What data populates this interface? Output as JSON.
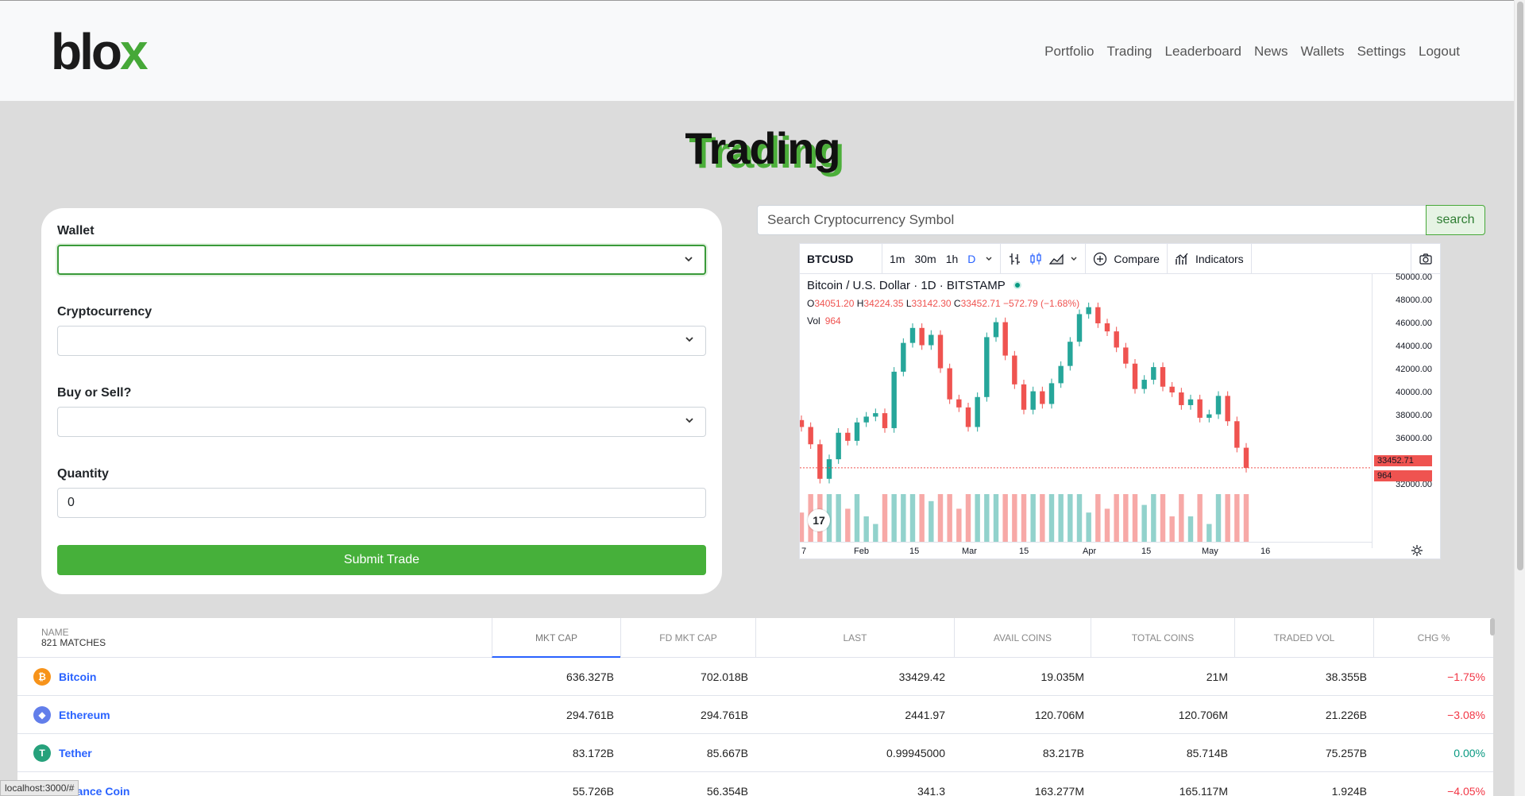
{
  "navbar": {
    "logo_main": "blo",
    "logo_accent": "x",
    "links": [
      "Portfolio",
      "Trading",
      "Leaderboard",
      "News",
      "Wallets",
      "Settings",
      "Logout"
    ]
  },
  "page": {
    "title": "Trading"
  },
  "form": {
    "wallet_label": "Wallet",
    "crypto_label": "Cryptocurrency",
    "side_label": "Buy or Sell?",
    "quantity_label": "Quantity",
    "quantity_value": "0",
    "submit_label": "Submit Trade"
  },
  "search": {
    "placeholder": "Search Cryptocurrency Symbol",
    "button_label": "search"
  },
  "chart_widget": {
    "symbol": "BTCUSD",
    "intervals": [
      "1m",
      "30m",
      "1h",
      "D"
    ],
    "active_interval": "D",
    "compare_label": "Compare",
    "indicators_label": "Indicators",
    "legend": "Bitcoin / U.S. Dollar · 1D · BITSTAMP",
    "ohlc": {
      "o": "34051.20",
      "h": "34224.35",
      "l": "33142.30",
      "c": "33452.71",
      "chg": "−572.79 (−1.68%)"
    },
    "vol_label": "Vol",
    "vol_value": "964",
    "last_price_tag": "33452.71",
    "vol_tag": "964",
    "logo": "17"
  },
  "chart_data": {
    "type": "candlestick",
    "x_labels": [
      "7",
      "Feb",
      "15",
      "Mar",
      "15",
      "Apr",
      "15",
      "May",
      "16"
    ],
    "y_ticks": [
      "50000.00",
      "48000.00",
      "46000.00",
      "44000.00",
      "42000.00",
      "40000.00",
      "38000.00",
      "36000.00",
      "34000.00",
      "32000.00"
    ],
    "ylim": [
      32000,
      50000
    ],
    "close_series": [
      37000,
      35500,
      32500,
      34200,
      36500,
      35800,
      37400,
      37900,
      38200,
      36900,
      41800,
      44300,
      45600,
      44100,
      45000,
      42100,
      39400,
      38700,
      37000,
      39600,
      44800,
      46100,
      43200,
      40700,
      38500,
      40100,
      39000,
      40800,
      42300,
      44400,
      46800,
      47400,
      46000,
      45300,
      43900,
      42500,
      40300,
      41100,
      42200,
      40500,
      40000,
      38900,
      39400,
      37800,
      38100,
      39700,
      37500,
      35200,
      33452.71
    ]
  },
  "table": {
    "name_header": "NAME",
    "matches": "821 MATCHES",
    "headers": [
      "MKT CAP",
      "FD MKT CAP",
      "LAST",
      "AVAIL COINS",
      "TOTAL COINS",
      "TRADED VOL",
      "CHG %"
    ],
    "rows": [
      {
        "icon": "₿",
        "color": "#f7931a",
        "name": "Bitcoin",
        "values": [
          "636.327B",
          "702.018B",
          "33429.42",
          "19.035M",
          "21M",
          "38.355B",
          "−1.75%"
        ],
        "dir": "neg"
      },
      {
        "icon": "◆",
        "color": "#627eea",
        "name": "Ethereum",
        "values": [
          "294.761B",
          "294.761B",
          "2441.97",
          "120.706M",
          "120.706M",
          "21.226B",
          "−3.08%"
        ],
        "dir": "neg"
      },
      {
        "icon": "T",
        "color": "#26a17b",
        "name": "Tether",
        "values": [
          "83.172B",
          "85.667B",
          "0.99945000",
          "83.217B",
          "85.714B",
          "75.257B",
          "0.00%"
        ],
        "dir": "pos"
      },
      {
        "icon": "B",
        "color": "#f3ba2f",
        "name": "Binance Coin",
        "values": [
          "55.726B",
          "56.354B",
          "341.3",
          "163.277M",
          "165.117M",
          "1.924B",
          "−4.05%"
        ],
        "dir": "neg"
      }
    ]
  },
  "status_bar": {
    "url": "localhost:3000/#"
  }
}
